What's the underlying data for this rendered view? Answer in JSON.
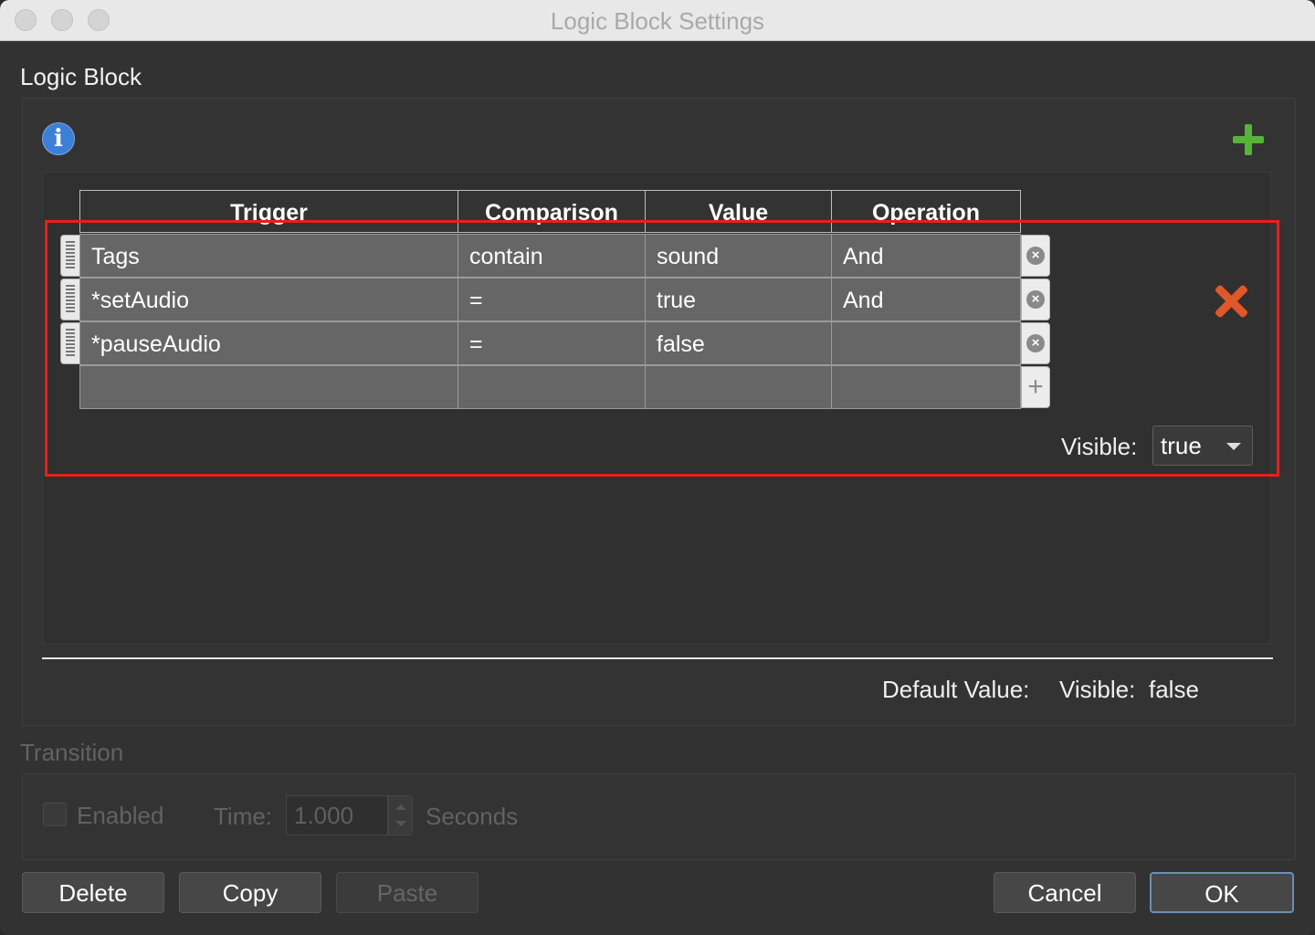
{
  "window": {
    "title": "Logic Block Settings"
  },
  "logic_block": {
    "section_label": "Logic Block",
    "columns": [
      "Trigger",
      "Comparison",
      "Value",
      "Operation"
    ],
    "rows": [
      {
        "trigger": "Tags",
        "comparison": "contain",
        "value": "sound",
        "operation": "And"
      },
      {
        "trigger": "*setAudio",
        "comparison": "=",
        "value": "true",
        "operation": "And"
      },
      {
        "trigger": "*pauseAudio",
        "comparison": "=",
        "value": "false",
        "operation": ""
      },
      {
        "trigger": "",
        "comparison": "",
        "value": "",
        "operation": ""
      }
    ],
    "visible_label": "Visible:",
    "visible_value": "true",
    "default_value_label": "Default Value:",
    "default_visible_label": "Visible:",
    "default_visible_value": "false"
  },
  "transition": {
    "section_label": "Transition",
    "enabled_label": "Enabled",
    "enabled_checked": false,
    "time_label": "Time:",
    "time_value": "1.000",
    "seconds_label": "Seconds"
  },
  "buttons": {
    "delete": "Delete",
    "copy": "Copy",
    "paste": "Paste",
    "cancel": "Cancel",
    "ok": "OK"
  },
  "icons": {
    "info": "info-icon",
    "add_block": "plus-icon",
    "remove_block": "close-icon",
    "row_delete": "circle-x-icon",
    "row_add": "plus-icon"
  },
  "colors": {
    "highlight": "#e3221c",
    "add_green": "#58b33a",
    "remove_orange": "#e0572a",
    "info_blue": "#3d7fd6"
  }
}
